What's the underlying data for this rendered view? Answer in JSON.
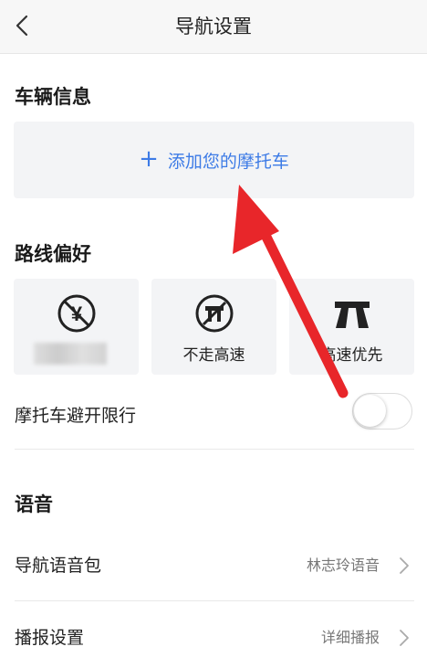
{
  "header": {
    "title": "导航设置",
    "back_icon": "chevron-left-icon"
  },
  "vehicle": {
    "section_title": "车辆信息",
    "add_label": "添加您的摩托车",
    "accent": "#3d7be6"
  },
  "route": {
    "section_title": "路线偏好",
    "cards": [
      {
        "icon": "no-toll-icon",
        "label": ""
      },
      {
        "icon": "no-highway-icon",
        "label": "不走高速"
      },
      {
        "icon": "highway-icon",
        "label": "高速优先"
      }
    ],
    "restriction_label": "摩托车避开限行",
    "restriction_enabled": false
  },
  "voice": {
    "section_title": "语音",
    "voice_pack_label": "导航语音包",
    "voice_pack_value": "林志玲语音",
    "broadcast_label": "播报设置",
    "broadcast_value": "详细播报"
  },
  "annotation": {
    "color": "#e8262a"
  }
}
